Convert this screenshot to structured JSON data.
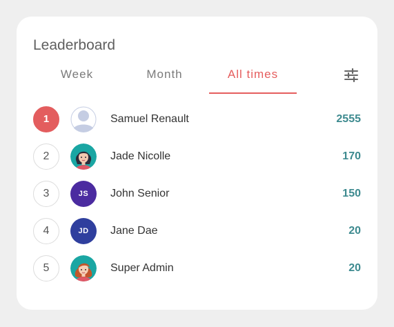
{
  "header": {
    "title": "Leaderboard"
  },
  "tabs": [
    {
      "label": "Week",
      "active": false
    },
    {
      "label": "Month",
      "active": false
    },
    {
      "label": "All times",
      "active": true
    }
  ],
  "filter": {
    "icon": "sliders-icon"
  },
  "colors": {
    "accent": "#e55d5d",
    "score": "#3d8a8f",
    "avatar_js": "#4b2ba0",
    "avatar_jd": "#2f3f9e"
  },
  "leaderboard": [
    {
      "rank": "1",
      "name": "Samuel Renault",
      "score": "2555",
      "avatar": "default-avatar-icon"
    },
    {
      "rank": "2",
      "name": "Jade Nicolle",
      "score": "170",
      "avatar": "woman-avatar-icon"
    },
    {
      "rank": "3",
      "name": "John Senior",
      "score": "150",
      "avatar_initials": "JS"
    },
    {
      "rank": "4",
      "name": "Jane Dae",
      "score": "20",
      "avatar_initials": "JD"
    },
    {
      "rank": "5",
      "name": "Super Admin",
      "score": "20",
      "avatar": "redhead-avatar-icon"
    }
  ]
}
